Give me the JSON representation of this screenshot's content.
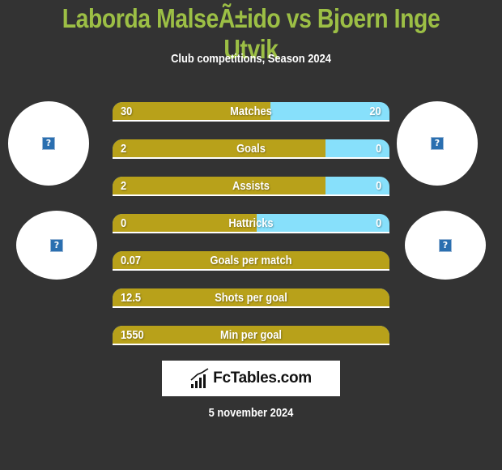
{
  "header": {
    "title": "Laborda MalseÃ±ido vs Bjoern Inge Utvik",
    "subtitle": "Club competitions, Season 2024"
  },
  "players": {
    "left": {
      "avatar_icon": "broken-image-icon",
      "club_icon": "broken-image-icon"
    },
    "right": {
      "avatar_icon": "broken-image-icon",
      "club_icon": "broken-image-icon"
    }
  },
  "stats": [
    {
      "label": "Matches",
      "left": "30",
      "right": "20",
      "left_fill": 0.57
    },
    {
      "label": "Goals",
      "left": "2",
      "right": "0",
      "left_fill": 0.77
    },
    {
      "label": "Assists",
      "left": "2",
      "right": "0",
      "left_fill": 0.77
    },
    {
      "label": "Hattricks",
      "left": "0",
      "right": "0",
      "left_fill": 0.52
    },
    {
      "label": "Goals per match",
      "left": "0.07",
      "right": "",
      "left_fill": 1.0
    },
    {
      "label": "Shots per goal",
      "left": "12.5",
      "right": "",
      "left_fill": 1.0
    },
    {
      "label": "Min per goal",
      "left": "1550",
      "right": "",
      "left_fill": 1.0
    }
  ],
  "colors": {
    "left_bar": "#b8a11a",
    "right_bar": "#87e0fb",
    "title": "#9cbf45",
    "background": "#333333"
  },
  "logo": {
    "text": "FcTables.com",
    "icon": "bar-chart-icon"
  },
  "footer": {
    "date": "5 november 2024"
  }
}
